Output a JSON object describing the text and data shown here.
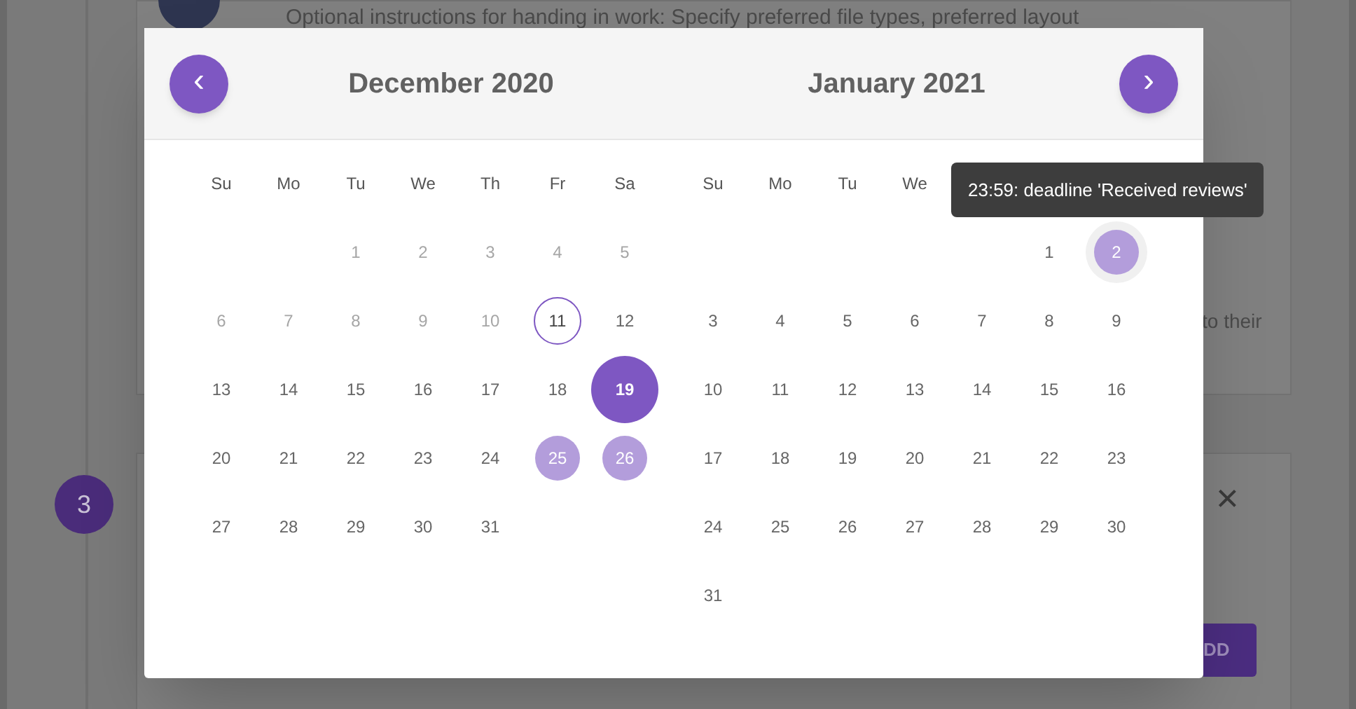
{
  "background": {
    "instructions": "Optional instructions for handing in work: Specify preferred file types, preferred layout",
    "fragment": "to their",
    "step": "3",
    "close": "×",
    "button": "DD"
  },
  "picker": {
    "prev": "‹",
    "next": "›",
    "months": [
      {
        "title": "December 2020",
        "weekdays": [
          "Su",
          "Mo",
          "Tu",
          "We",
          "Th",
          "Fr",
          "Sa"
        ],
        "weeks": [
          {
            "kind": "leading",
            "days": [
              {
                "label": "1",
                "kind": "disabled"
              },
              {
                "label": "2",
                "kind": "disabled"
              },
              {
                "label": "3",
                "kind": "disabled"
              },
              {
                "label": "4",
                "kind": "disabled"
              },
              {
                "label": "5",
                "kind": "disabled"
              }
            ]
          },
          {
            "kind": "regular",
            "days": [
              {
                "label": "6",
                "kind": "disabled"
              },
              {
                "label": "7",
                "kind": "disabled"
              },
              {
                "label": "8",
                "kind": "disabled"
              },
              {
                "label": "9",
                "kind": "disabled"
              },
              {
                "label": "10",
                "kind": "disabled"
              },
              {
                "label": "11",
                "kind": "today"
              },
              {
                "label": "12",
                "kind": "normal"
              }
            ]
          },
          {
            "kind": "regular",
            "days": [
              {
                "label": "13",
                "kind": "normal"
              },
              {
                "label": "14",
                "kind": "normal"
              },
              {
                "label": "15",
                "kind": "normal"
              },
              {
                "label": "16",
                "kind": "normal"
              },
              {
                "label": "17",
                "kind": "normal"
              },
              {
                "label": "18",
                "kind": "normal"
              },
              {
                "label": "19",
                "kind": "selected"
              }
            ]
          },
          {
            "kind": "regular",
            "days": [
              {
                "label": "20",
                "kind": "normal"
              },
              {
                "label": "21",
                "kind": "normal"
              },
              {
                "label": "22",
                "kind": "normal"
              },
              {
                "label": "23",
                "kind": "normal"
              },
              {
                "label": "24",
                "kind": "normal"
              },
              {
                "label": "25",
                "kind": "event"
              },
              {
                "label": "26",
                "kind": "event"
              }
            ]
          },
          {
            "kind": "regular",
            "days": [
              {
                "label": "27",
                "kind": "normal"
              },
              {
                "label": "28",
                "kind": "normal"
              },
              {
                "label": "29",
                "kind": "normal"
              },
              {
                "label": "30",
                "kind": "normal"
              },
              {
                "label": "31",
                "kind": "normal"
              }
            ]
          }
        ]
      },
      {
        "title": "January 2021",
        "weekdays": [
          "Su",
          "Mo",
          "Tu",
          "We"
        ],
        "weeks": [
          {
            "kind": "leading",
            "days": [
              {
                "label": "1",
                "kind": "normal"
              },
              {
                "label": "2",
                "kind": "hovered"
              }
            ]
          },
          {
            "kind": "regular",
            "days": [
              {
                "label": "3",
                "kind": "normal"
              },
              {
                "label": "4",
                "kind": "normal"
              },
              {
                "label": "5",
                "kind": "normal"
              },
              {
                "label": "6",
                "kind": "normal"
              },
              {
                "label": "7",
                "kind": "normal"
              },
              {
                "label": "8",
                "kind": "normal"
              },
              {
                "label": "9",
                "kind": "normal"
              }
            ]
          },
          {
            "kind": "regular",
            "days": [
              {
                "label": "10",
                "kind": "normal"
              },
              {
                "label": "11",
                "kind": "normal"
              },
              {
                "label": "12",
                "kind": "normal"
              },
              {
                "label": "13",
                "kind": "normal"
              },
              {
                "label": "14",
                "kind": "normal"
              },
              {
                "label": "15",
                "kind": "normal"
              },
              {
                "label": "16",
                "kind": "normal"
              }
            ]
          },
          {
            "kind": "regular",
            "days": [
              {
                "label": "17",
                "kind": "normal"
              },
              {
                "label": "18",
                "kind": "normal"
              },
              {
                "label": "19",
                "kind": "normal"
              },
              {
                "label": "20",
                "kind": "normal"
              },
              {
                "label": "21",
                "kind": "normal"
              },
              {
                "label": "22",
                "kind": "normal"
              },
              {
                "label": "23",
                "kind": "normal"
              }
            ]
          },
          {
            "kind": "regular",
            "days": [
              {
                "label": "24",
                "kind": "normal"
              },
              {
                "label": "25",
                "kind": "normal"
              },
              {
                "label": "26",
                "kind": "normal"
              },
              {
                "label": "27",
                "kind": "normal"
              },
              {
                "label": "28",
                "kind": "normal"
              },
              {
                "label": "29",
                "kind": "normal"
              },
              {
                "label": "30",
                "kind": "normal"
              }
            ]
          },
          {
            "kind": "regular",
            "days": [
              {
                "label": "31",
                "kind": "normal"
              }
            ]
          }
        ]
      }
    ],
    "tooltip": "23:59: deadline 'Received reviews'"
  }
}
